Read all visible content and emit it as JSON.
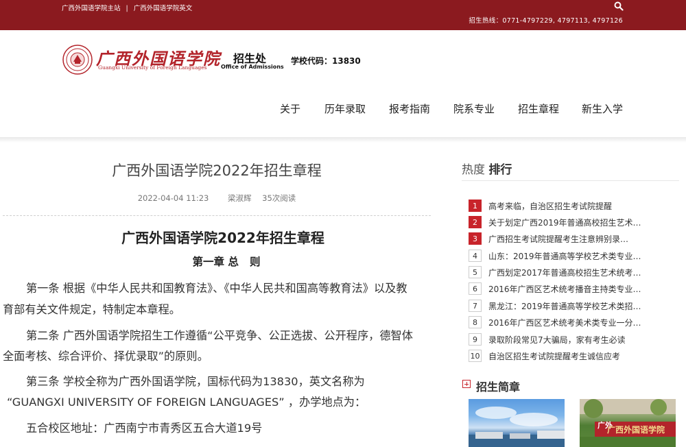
{
  "topbar": {
    "link_main": "广西外国语学院主站",
    "separator": "|",
    "link_en": "广西外国语学院英文",
    "hotline": "招生热线：0771-4797229, 4797113, 4797126",
    "search_icon": "search-icon"
  },
  "header": {
    "logo_script": "广西外国语学院",
    "logo_en": "Guangxi University of Foreign Languages",
    "office_cn": "招生处",
    "office_en": "Office of Admissions",
    "school_code": "学校代码：13830"
  },
  "nav": [
    "关于",
    "历年录取",
    "报考指南",
    "院系专业",
    "招生章程",
    "新生入学"
  ],
  "article": {
    "title": "广西外国语学院2022年招生章程",
    "date": "2022-04-04 11:23",
    "author": "梁淑辉",
    "views": "35次阅读",
    "doc_title": "广西外国语学院2022年招生章程",
    "chapter": "第一章 总   则",
    "paragraphs": [
      "第一条  根据《中华人民共和国教育法》、《中华人民共和国高等教育法》以及教",
      "育部有关文件规定，特制定本章程。",
      "第二条  广西外国语学院招生工作遵循“公平竞争、公正选拔、公开程序，德智体",
      "全面考核、综合评价、择优录取”的原则。",
      "第三条  学校全称为广西外国语学院，国标代码为13830，英文名称为",
      "“GUANGXI UNIVERSITY OF FOREIGN LANGUAGES” ，办学地点为：",
      "五合校区地址：广西南宁市青秀区五合大道19号"
    ]
  },
  "sidebar": {
    "hot_label": "热度",
    "rank_label": "排行",
    "ranking": [
      {
        "num": "1",
        "text": "高考来临，自治区招生考试院提醒"
      },
      {
        "num": "2",
        "text": "关于划定广西2019年普通高校招生艺术…"
      },
      {
        "num": "3",
        "text": "广西招生考试院提醒考生注意辨别录…"
      },
      {
        "num": "4",
        "text": "山东：2019年普通高等学校艺术类专业…"
      },
      {
        "num": "5",
        "text": "广西划定2017年普通高校招生艺术统考…"
      },
      {
        "num": "6",
        "text": "2016年广西区艺术统考播音主持类专业…"
      },
      {
        "num": "7",
        "text": "黑龙江：2019年普通高等学校艺术类招…"
      },
      {
        "num": "8",
        "text": "2016年广西区艺术统考美术类专业一分…"
      },
      {
        "num": "9",
        "text": "录取阶段常见7大骗局，家有考生必读"
      },
      {
        "num": "10",
        "text": "自治区招生考试院提醒考生诚信应考"
      }
    ],
    "brief_title": "招生简章",
    "sign_left": "广外",
    "sign_text": "广西外国语学院"
  },
  "colors": {
    "brand_red": "#8b1a1f",
    "rank_hot": "#c8242b"
  }
}
